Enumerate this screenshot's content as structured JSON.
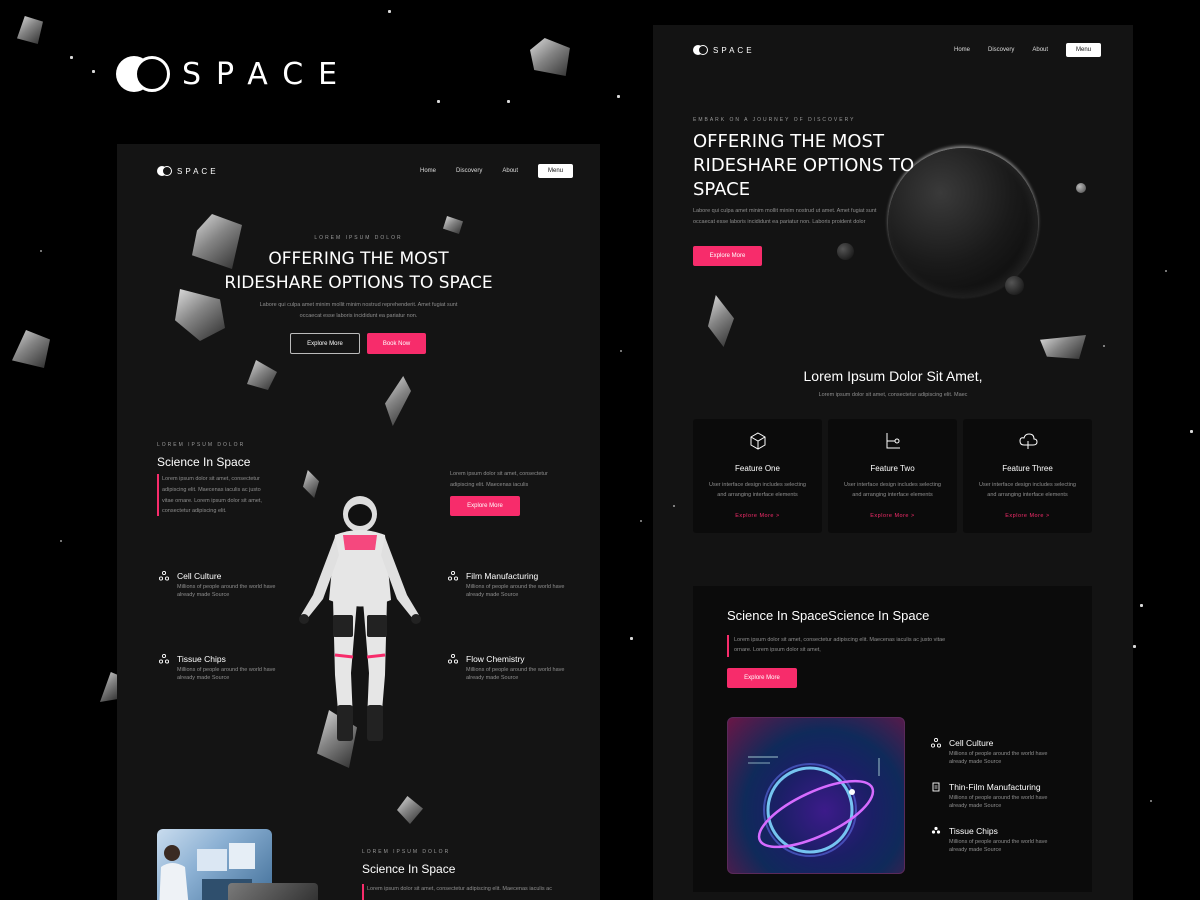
{
  "brand": {
    "name": "SPACE"
  },
  "left": {
    "nav": {
      "logo": "SPACE",
      "links": [
        "Home",
        "Discovery",
        "About"
      ],
      "menu": "Menu"
    },
    "hero": {
      "eyebrow": "LOREM IPSUM DOLOR",
      "title_line1": "OFFERING THE MOST",
      "title_line2": "RIDESHARE OPTIONS TO SPACE",
      "body_line1": "Labore qui culpa amet minim mollit minim nostrud reprehenderit. Amet fugiat sunt",
      "body_line2": "occaecat esse laboris incididunt ea pariatur non.",
      "btn_explore": "Explore More",
      "btn_book": "Book Now"
    },
    "science": {
      "eyebrow": "LOREM IPSUM DOLOR",
      "title": "Science In Space",
      "body_line1": "Lorem ipsum dolor sit amet, consectetur",
      "body_line2": "adipiscing elit. Maecenas iaculis ac justo",
      "body_line3": "vitae ornare. Lorem ipsum dolor sit amet,",
      "body_line4": "consectetur adipiscing elit.",
      "right_line1": "Lorem ipsum dolor sit amet, consectetur",
      "right_line2": "adipiscing elit. Maecenas iaculis",
      "btn": "Explore More"
    },
    "features": [
      {
        "title": "Cell Culture",
        "desc": "Millions of people around the world have already made Source"
      },
      {
        "title": "Film Manufacturing",
        "desc": "Millions of people around the world have already made Source"
      },
      {
        "title": "Tissue Chips",
        "desc": "Millions of people around the world have already made Source"
      },
      {
        "title": "Flow Chemistry",
        "desc": "Millions of people around the world have already made Source"
      }
    ],
    "bottom": {
      "eyebrow": "LOREM IPSUM DOLOR",
      "title": "Science In Space",
      "body": "Lorem ipsum dolor sit amet, consectetur adipiscing elit. Maecenas iaculis ac"
    }
  },
  "right": {
    "nav": {
      "logo": "SPACE",
      "links": [
        "Home",
        "Discovery",
        "About"
      ],
      "menu": "Menu"
    },
    "hero": {
      "eyebrow": "EMBARK ON A JOURNEY OF DISCOVERY",
      "title_line1": "OFFERING THE MOST",
      "title_line2": "RIDESHARE OPTIONS TO",
      "title_line3": "SPACE",
      "body_line1": "Labore qui culpa amet minim mollit minim nostrud ut amet. Amet fugiat sunt",
      "body_line2": "occaecat esse laboris incididunt ea pariatur non. Laboris proident dolor",
      "btn": "Explore More"
    },
    "section": {
      "title": "Lorem Ipsum Dolor Sit Amet,",
      "subtitle": "Lorem ipsum dolor sit amet, consectetur adipiscing elit. Maec"
    },
    "cards": [
      {
        "title": "Feature One",
        "desc_line1": "User interface design includes selecting",
        "desc_line2": "and arranging interface elements",
        "link": "Explore More  >"
      },
      {
        "title": "Feature Two",
        "desc_line1": "User interface design includes selecting",
        "desc_line2": "and arranging interface elements",
        "link": "Explore More  >"
      },
      {
        "title": "Feature Three",
        "desc_line1": "User interface design includes selecting",
        "desc_line2": "and arranging interface elements",
        "link": "Explore More  >"
      }
    ],
    "science": {
      "title": "Science In SpaceScience In Space",
      "body_line1": "Lorem ipsum dolor sit amet, consectetur adipiscing elit. Maecenas iaculis ac justo vitae",
      "body_line2": "ornare. Lorem ipsum dolor sit amet,",
      "btn": "Explore More",
      "items": [
        {
          "title": "Cell Culture",
          "desc": "Millions of people around the world have already made Source"
        },
        {
          "title": "Thin-Film Manufacturing",
          "desc": "Millions of people around the world have already made Source"
        },
        {
          "title": "Tissue Chips",
          "desc": "Millions of people around the world have already made Source"
        }
      ]
    }
  },
  "colors": {
    "accent": "#f72c6b",
    "background": "#000000",
    "panel": "#141414"
  }
}
